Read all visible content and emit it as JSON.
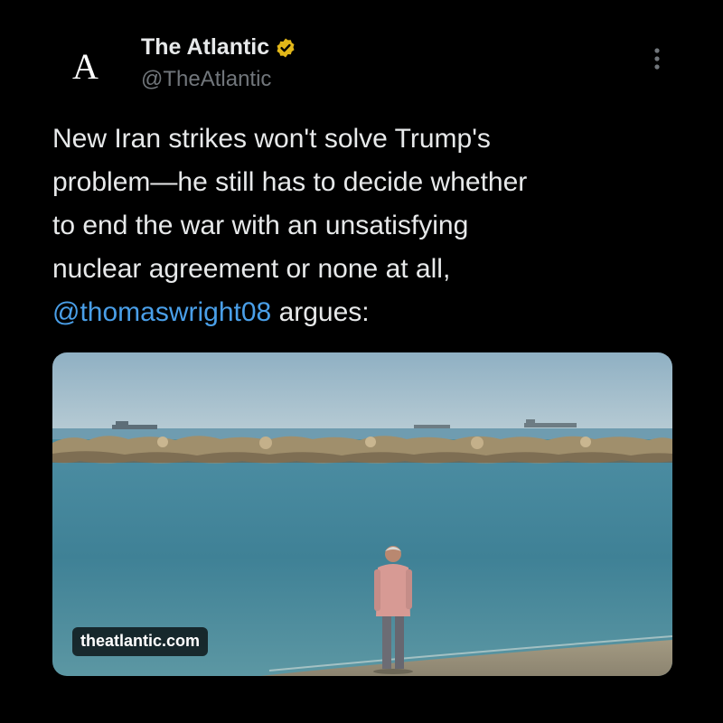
{
  "account": {
    "display_name": "The Atlantic",
    "handle": "@TheAtlantic",
    "avatar_letter": "A",
    "verified_color": "#e2b719"
  },
  "tweet": {
    "text_before": "New Iran strikes won't solve Trump's\nproblem—he still has to decide whether\nto end the war with an unsatisfying\nnuclear agreement or none at all,\n",
    "mention": "@thomaswright08",
    "text_after": " argues:"
  },
  "card": {
    "domain": "theatlantic.com"
  },
  "icons": {
    "verified": "verified-badge-icon",
    "more": "more-vertical-icon"
  },
  "colors": {
    "background": "#000000",
    "text": "#e7e9ea",
    "secondary": "#71767b",
    "link": "#4a9fe8"
  }
}
